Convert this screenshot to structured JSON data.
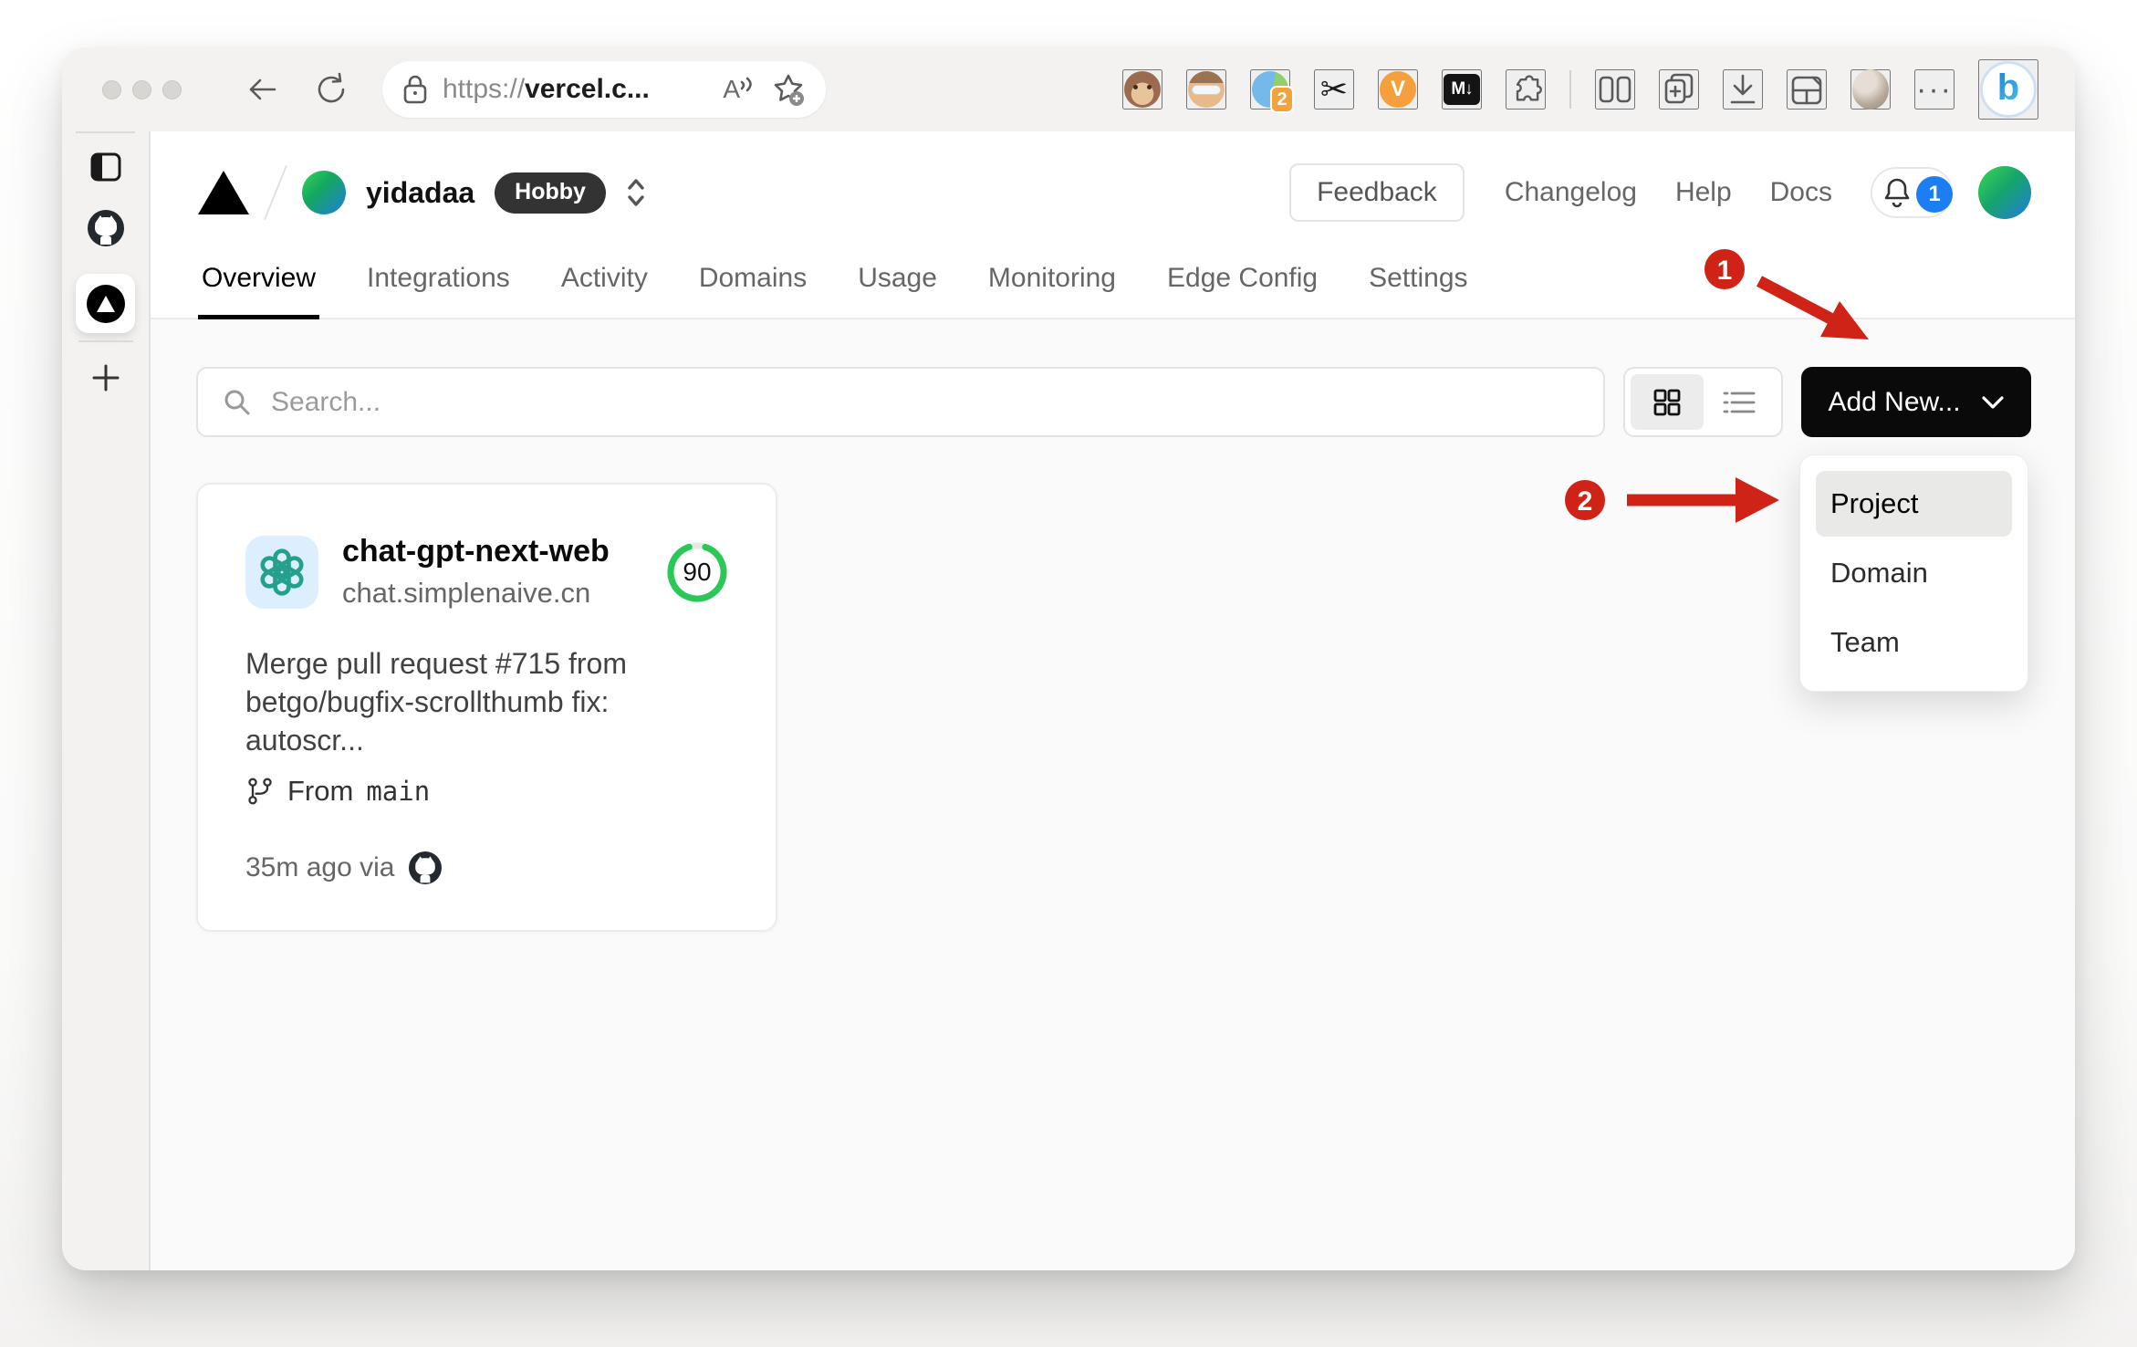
{
  "browser": {
    "url": {
      "scheme": "https://",
      "host": "vercel.c..."
    },
    "read_aloud_label": "A",
    "extensions": {
      "duo_badge": "2",
      "scissors_glyph": "✂",
      "v_label": "V",
      "markdown_label": "M↓",
      "ellipsis": "···",
      "bing_label": "b"
    }
  },
  "site": {
    "team": "yidadaa",
    "plan": "Hobby",
    "header": {
      "feedback": "Feedback",
      "links": [
        "Changelog",
        "Help",
        "Docs"
      ],
      "notification_count": "1"
    },
    "tabs": [
      "Overview",
      "Integrations",
      "Activity",
      "Domains",
      "Usage",
      "Monitoring",
      "Edge Config",
      "Settings"
    ],
    "toolbar": {
      "search_placeholder": "Search...",
      "add_new": "Add New..."
    },
    "dropdown": {
      "items": [
        "Project",
        "Domain",
        "Team"
      ]
    },
    "card": {
      "name": "chat-gpt-next-web",
      "domain": "chat.simplenaive.cn",
      "score": "90",
      "commit": "Merge pull request #715 from betgo/bugfix-scrollthumb fix: autoscr...",
      "from_label": "From",
      "branch": "main",
      "deployed": "35m ago via"
    }
  },
  "annotations": {
    "step1": "1",
    "step2": "2"
  },
  "colors": {
    "annotation_red": "#d02318",
    "notification_blue": "#1d7ef2",
    "score_green": "#2bc757",
    "add_new_black": "#0a0a0a",
    "plan_badge": "#333333"
  }
}
